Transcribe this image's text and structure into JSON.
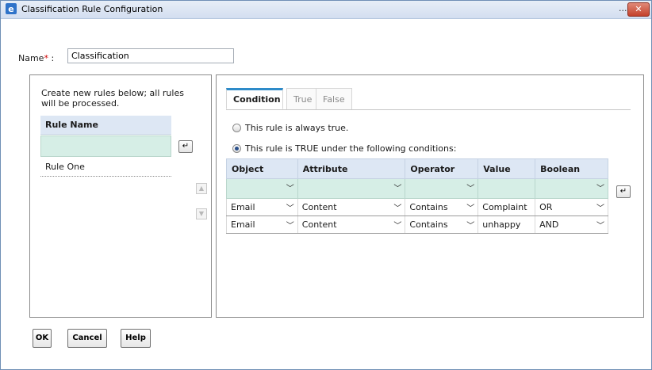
{
  "window": {
    "title": "Classification Rule Configuration",
    "more": "...",
    "close": "✕"
  },
  "name_field": {
    "label": "Name",
    "required_mark": "*",
    "colon": " :",
    "value": "Classification"
  },
  "rules_panel": {
    "hint": "Create new rules below; all rules will be processed.",
    "column_header": "Rule Name",
    "new_rule_value": "",
    "rows": [
      "Rule One"
    ],
    "enter_glyph": "↵",
    "up_glyph": "▲",
    "down_glyph": "▼"
  },
  "tabs": [
    "Condition",
    "True",
    "False"
  ],
  "conditions": {
    "always_true_label": "This rule is always true.",
    "conditional_label": "This rule is TRUE under the following conditions:",
    "selected": "conditional",
    "columns": [
      "Object",
      "Attribute",
      "Operator",
      "Value",
      "Boolean"
    ],
    "rows": [
      [
        "Email",
        "Content",
        "Contains",
        "Complaint",
        "OR"
      ],
      [
        "Email",
        "Content",
        "Contains",
        "unhappy",
        "AND"
      ]
    ],
    "enter_glyph": "↵",
    "chevron": "﹀"
  },
  "buttons": {
    "ok": "OK",
    "cancel": "Cancel",
    "help": "Help"
  },
  "colors": {
    "header_bg": "#dde7f4",
    "filter_bg": "#d6eee6",
    "tab_accent": "#2e8bc9",
    "close_red": "#c4412c"
  }
}
